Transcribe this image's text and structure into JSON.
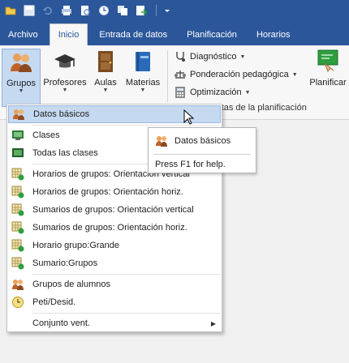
{
  "quick_access": {
    "icons": [
      "folder-icon",
      "save-icon",
      "undo-icon",
      "print-icon",
      "print-preview-icon",
      "timer-icon",
      "copy-icon",
      "export-icon",
      "customize-icon"
    ]
  },
  "tabs": [
    {
      "label": "Archivo",
      "active": false
    },
    {
      "label": "Inicio",
      "active": true
    },
    {
      "label": "Entrada de datos",
      "active": false
    },
    {
      "label": "Planificación",
      "active": false
    },
    {
      "label": "Horarios",
      "active": false
    }
  ],
  "ribbon": {
    "grupos": "Grupos",
    "profesores": "Profesores",
    "aulas": "Aulas",
    "materias": "Materias",
    "diagnostico": "Diagnóstico",
    "ponderacion": "Ponderación pedagógica",
    "optimizacion": "Optimización",
    "group_label": "ientas de la planificación",
    "planificar": "Planificar"
  },
  "menu": {
    "items": [
      {
        "label": "Datos básicos",
        "icon": "groups-icon",
        "highlighted": true
      },
      {
        "label": "Clases",
        "icon": "classes-icon"
      },
      {
        "label": "Todas las clases",
        "icon": "all-classes-icon"
      },
      {
        "label": "Horarios de grupos: Orientación vertical",
        "icon": "timetable-icon"
      },
      {
        "label": "Horarios de grupos: Orientación horiz.",
        "icon": "timetable-icon"
      },
      {
        "label": "Sumarios de grupos: Orientación vertical",
        "icon": "timetable-icon"
      },
      {
        "label": "Sumarios de grupos: Orientación horiz.",
        "icon": "timetable-icon"
      },
      {
        "label": "Horario grupo:Grande",
        "icon": "timetable-icon"
      },
      {
        "label": "Sumario:Grupos",
        "icon": "timetable-icon"
      },
      {
        "label": "Grupos de alumnos",
        "icon": "student-groups-icon"
      },
      {
        "label": "Peti/Desid.",
        "icon": "clock-icon"
      },
      {
        "label": "Conjunto vent.",
        "icon": "",
        "submenu": true
      }
    ]
  },
  "tooltip": {
    "title": "Datos básicos",
    "help": "Press F1 for help."
  }
}
